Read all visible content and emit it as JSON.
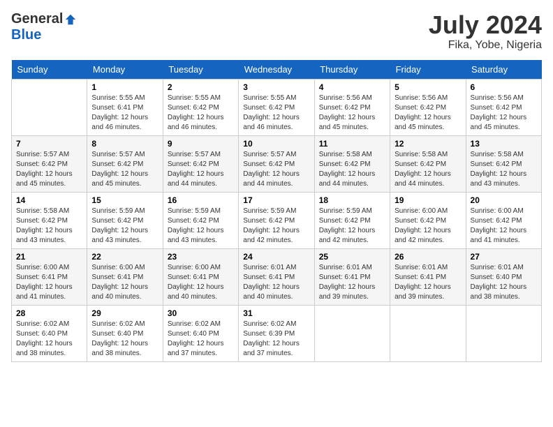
{
  "header": {
    "logo_general": "General",
    "logo_blue": "Blue",
    "month_title": "July 2024",
    "location": "Fika, Yobe, Nigeria"
  },
  "days_of_week": [
    "Sunday",
    "Monday",
    "Tuesday",
    "Wednesday",
    "Thursday",
    "Friday",
    "Saturday"
  ],
  "weeks": [
    [
      {
        "day": "",
        "sunrise": "",
        "sunset": "",
        "daylight": ""
      },
      {
        "day": "1",
        "sunrise": "Sunrise: 5:55 AM",
        "sunset": "Sunset: 6:41 PM",
        "daylight": "Daylight: 12 hours and 46 minutes."
      },
      {
        "day": "2",
        "sunrise": "Sunrise: 5:55 AM",
        "sunset": "Sunset: 6:42 PM",
        "daylight": "Daylight: 12 hours and 46 minutes."
      },
      {
        "day": "3",
        "sunrise": "Sunrise: 5:55 AM",
        "sunset": "Sunset: 6:42 PM",
        "daylight": "Daylight: 12 hours and 46 minutes."
      },
      {
        "day": "4",
        "sunrise": "Sunrise: 5:56 AM",
        "sunset": "Sunset: 6:42 PM",
        "daylight": "Daylight: 12 hours and 45 minutes."
      },
      {
        "day": "5",
        "sunrise": "Sunrise: 5:56 AM",
        "sunset": "Sunset: 6:42 PM",
        "daylight": "Daylight: 12 hours and 45 minutes."
      },
      {
        "day": "6",
        "sunrise": "Sunrise: 5:56 AM",
        "sunset": "Sunset: 6:42 PM",
        "daylight": "Daylight: 12 hours and 45 minutes."
      }
    ],
    [
      {
        "day": "7",
        "sunrise": "Sunrise: 5:57 AM",
        "sunset": "Sunset: 6:42 PM",
        "daylight": "Daylight: 12 hours and 45 minutes."
      },
      {
        "day": "8",
        "sunrise": "Sunrise: 5:57 AM",
        "sunset": "Sunset: 6:42 PM",
        "daylight": "Daylight: 12 hours and 45 minutes."
      },
      {
        "day": "9",
        "sunrise": "Sunrise: 5:57 AM",
        "sunset": "Sunset: 6:42 PM",
        "daylight": "Daylight: 12 hours and 44 minutes."
      },
      {
        "day": "10",
        "sunrise": "Sunrise: 5:57 AM",
        "sunset": "Sunset: 6:42 PM",
        "daylight": "Daylight: 12 hours and 44 minutes."
      },
      {
        "day": "11",
        "sunrise": "Sunrise: 5:58 AM",
        "sunset": "Sunset: 6:42 PM",
        "daylight": "Daylight: 12 hours and 44 minutes."
      },
      {
        "day": "12",
        "sunrise": "Sunrise: 5:58 AM",
        "sunset": "Sunset: 6:42 PM",
        "daylight": "Daylight: 12 hours and 44 minutes."
      },
      {
        "day": "13",
        "sunrise": "Sunrise: 5:58 AM",
        "sunset": "Sunset: 6:42 PM",
        "daylight": "Daylight: 12 hours and 43 minutes."
      }
    ],
    [
      {
        "day": "14",
        "sunrise": "Sunrise: 5:58 AM",
        "sunset": "Sunset: 6:42 PM",
        "daylight": "Daylight: 12 hours and 43 minutes."
      },
      {
        "day": "15",
        "sunrise": "Sunrise: 5:59 AM",
        "sunset": "Sunset: 6:42 PM",
        "daylight": "Daylight: 12 hours and 43 minutes."
      },
      {
        "day": "16",
        "sunrise": "Sunrise: 5:59 AM",
        "sunset": "Sunset: 6:42 PM",
        "daylight": "Daylight: 12 hours and 43 minutes."
      },
      {
        "day": "17",
        "sunrise": "Sunrise: 5:59 AM",
        "sunset": "Sunset: 6:42 PM",
        "daylight": "Daylight: 12 hours and 42 minutes."
      },
      {
        "day": "18",
        "sunrise": "Sunrise: 5:59 AM",
        "sunset": "Sunset: 6:42 PM",
        "daylight": "Daylight: 12 hours and 42 minutes."
      },
      {
        "day": "19",
        "sunrise": "Sunrise: 6:00 AM",
        "sunset": "Sunset: 6:42 PM",
        "daylight": "Daylight: 12 hours and 42 minutes."
      },
      {
        "day": "20",
        "sunrise": "Sunrise: 6:00 AM",
        "sunset": "Sunset: 6:42 PM",
        "daylight": "Daylight: 12 hours and 41 minutes."
      }
    ],
    [
      {
        "day": "21",
        "sunrise": "Sunrise: 6:00 AM",
        "sunset": "Sunset: 6:41 PM",
        "daylight": "Daylight: 12 hours and 41 minutes."
      },
      {
        "day": "22",
        "sunrise": "Sunrise: 6:00 AM",
        "sunset": "Sunset: 6:41 PM",
        "daylight": "Daylight: 12 hours and 40 minutes."
      },
      {
        "day": "23",
        "sunrise": "Sunrise: 6:00 AM",
        "sunset": "Sunset: 6:41 PM",
        "daylight": "Daylight: 12 hours and 40 minutes."
      },
      {
        "day": "24",
        "sunrise": "Sunrise: 6:01 AM",
        "sunset": "Sunset: 6:41 PM",
        "daylight": "Daylight: 12 hours and 40 minutes."
      },
      {
        "day": "25",
        "sunrise": "Sunrise: 6:01 AM",
        "sunset": "Sunset: 6:41 PM",
        "daylight": "Daylight: 12 hours and 39 minutes."
      },
      {
        "day": "26",
        "sunrise": "Sunrise: 6:01 AM",
        "sunset": "Sunset: 6:41 PM",
        "daylight": "Daylight: 12 hours and 39 minutes."
      },
      {
        "day": "27",
        "sunrise": "Sunrise: 6:01 AM",
        "sunset": "Sunset: 6:40 PM",
        "daylight": "Daylight: 12 hours and 38 minutes."
      }
    ],
    [
      {
        "day": "28",
        "sunrise": "Sunrise: 6:02 AM",
        "sunset": "Sunset: 6:40 PM",
        "daylight": "Daylight: 12 hours and 38 minutes."
      },
      {
        "day": "29",
        "sunrise": "Sunrise: 6:02 AM",
        "sunset": "Sunset: 6:40 PM",
        "daylight": "Daylight: 12 hours and 38 minutes."
      },
      {
        "day": "30",
        "sunrise": "Sunrise: 6:02 AM",
        "sunset": "Sunset: 6:40 PM",
        "daylight": "Daylight: 12 hours and 37 minutes."
      },
      {
        "day": "31",
        "sunrise": "Sunrise: 6:02 AM",
        "sunset": "Sunset: 6:39 PM",
        "daylight": "Daylight: 12 hours and 37 minutes."
      },
      {
        "day": "",
        "sunrise": "",
        "sunset": "",
        "daylight": ""
      },
      {
        "day": "",
        "sunrise": "",
        "sunset": "",
        "daylight": ""
      },
      {
        "day": "",
        "sunrise": "",
        "sunset": "",
        "daylight": ""
      }
    ]
  ]
}
